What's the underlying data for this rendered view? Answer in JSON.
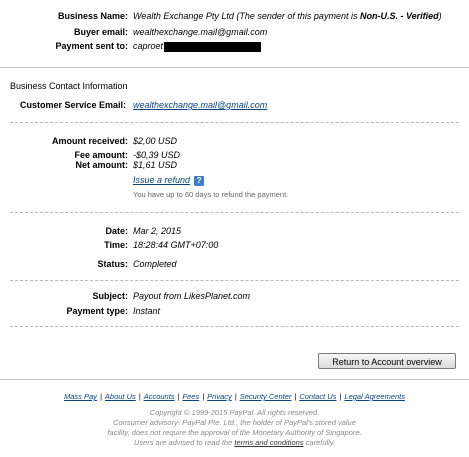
{
  "payer": {
    "business_name_label": "Business Name:",
    "business_name_value": "Wealth Exchange Pty Ltd (The sender of this payment is ",
    "non_us": "Non-U.S. - Verified",
    "close_paren": ")",
    "buyer_email_label": "Buyer email:",
    "buyer_email_value": "wealthexchange.mail@gmail.com",
    "payment_sent_label": "Payment sent to:",
    "payment_sent_value": "caproet"
  },
  "contact": {
    "section_title": "Business Contact Information",
    "cs_email_label": "Customer Service Email:",
    "cs_email_value": "wealthexchange.mail@gmail.com"
  },
  "amounts": {
    "received_label": "Amount received:",
    "received_value": "$2,00 USD",
    "fee_label": "Fee amount:",
    "fee_value": "-$0,39 USD",
    "net_label": "Net amount:",
    "net_value": "$1,61 USD",
    "refund_link": "Issue a refund",
    "refund_note": "You have up to 60 days to refund the payment."
  },
  "transaction": {
    "date_label": "Date:",
    "date_value": "Mar 2, 2015",
    "time_label": "Time:",
    "time_value": "18:28:44 GMT+07:00",
    "status_label": "Status:",
    "status_value": "Completed"
  },
  "details": {
    "subject_label": "Subject:",
    "subject_value": "Payout from LikesPlanet.com",
    "type_label": "Payment type:",
    "type_value": "Instant"
  },
  "actions": {
    "return_button": "Return to Account overview"
  },
  "footer": {
    "links": [
      "Mass Pay",
      "About Us",
      "Accounts",
      "Fees",
      "Privacy",
      "Security Center",
      "Contact Us",
      "Legal Agreements"
    ],
    "separator": "|",
    "copyright": "Copyright © 1999-2015 PayPal. All rights reserved.",
    "advisory_1": "Consumer advisory- PayPal Pte. Ltd., the holder of PayPal's stored value",
    "advisory_2": "facility, does not require the approval of the Monetary Authority of Singapore.",
    "advisory_3a": "Users are advised to read the ",
    "advisory_terms": "terms and conditions",
    "advisory_3b": " carefully."
  }
}
